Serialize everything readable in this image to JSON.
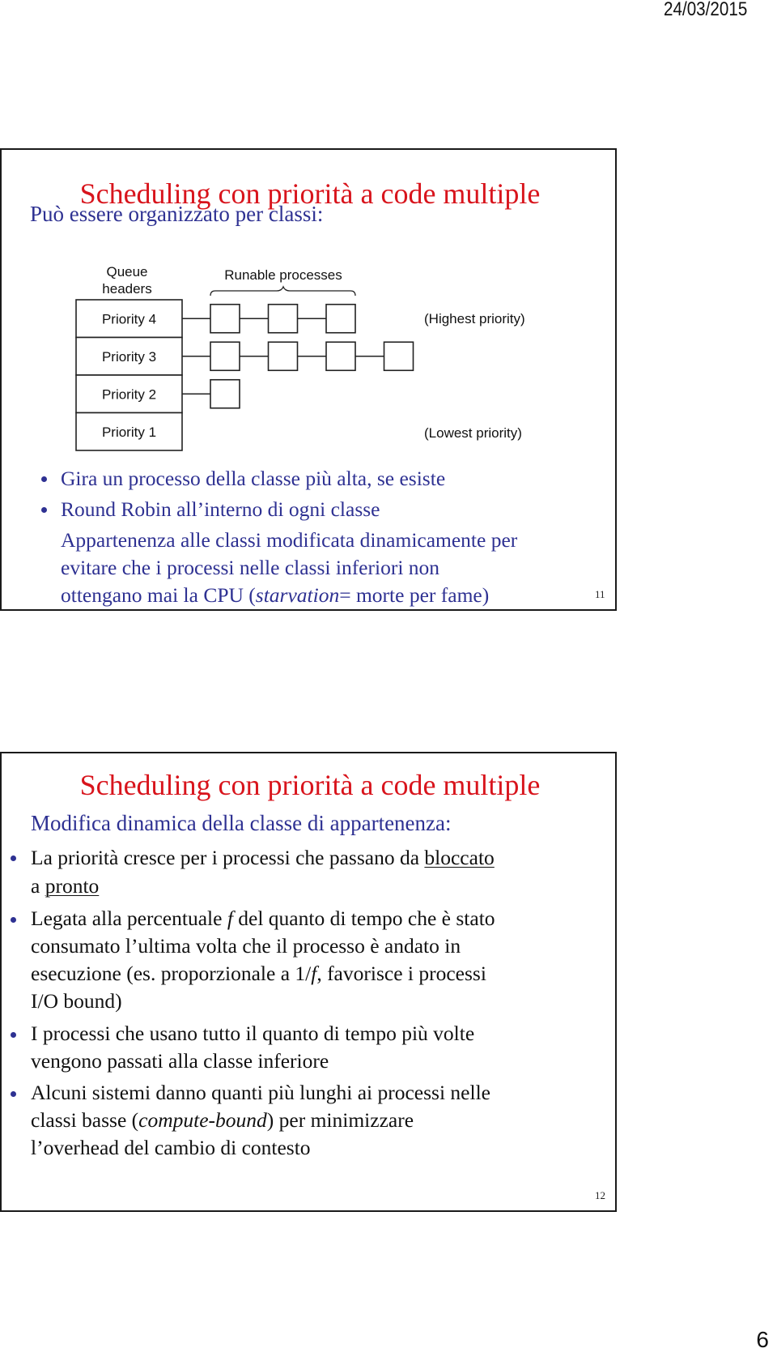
{
  "page": {
    "date": "24/03/2015",
    "page_number": "6"
  },
  "slides": [
    {
      "number": "11",
      "title": "Scheduling con priorità a code multiple",
      "subtitle": "Può essere organizzato per classi:",
      "diagram": {
        "header_label_line1": "Queue",
        "header_label_line2": "headers",
        "processes_label": "Runable processes",
        "highest_label": "(Highest priority)",
        "lowest_label": "(Lowest priority)",
        "queues": [
          {
            "label": "Priority 4",
            "process_count": 3
          },
          {
            "label": "Priority 3",
            "process_count": 4
          },
          {
            "label": "Priority 2",
            "process_count": 1
          },
          {
            "label": "Priority 1",
            "process_count": 0
          }
        ]
      },
      "bullets": [
        "Gira un processo della classe più alta, se esiste",
        "Round Robin all’interno di ogni classe"
      ],
      "paragraph": {
        "line1": "Appartenenza alle classi modificata dinamicamente per",
        "line2": "evitare che i processi nelle classi inferiori non",
        "line3_pre": "ottengano mai la CPU (",
        "line3_em": "starvation",
        "line3_post": "= morte per fame)"
      }
    },
    {
      "number": "12",
      "title": "Scheduling con priorità a code multiple",
      "subtitle": "Modifica dinamica della classe di appartenenza:",
      "bullets": [
        {
          "pre": "La priorità cresce per i processi che passano da ",
          "u1": "bloccato",
          "mid": "a ",
          "u2": "pronto"
        },
        {
          "line1_pre": "Legata alla percentuale ",
          "line1_em": "f",
          "line1_post": " del quanto di tempo che è stato",
          "line2": "consumato l’ultima volta che il processo è andato in",
          "line3_pre": "esecuzione (es. proporzionale a 1/",
          "line3_em": "f",
          "line3_post": ", favorisce i processi",
          "line4": "I/O bound)"
        },
        {
          "line1": "I processi che usano tutto il quanto di tempo più volte",
          "line2": "vengono passati alla classe inferiore"
        },
        {
          "line1": "Alcuni sistemi danno quanti più lunghi ai processi nelle",
          "line2_pre": "classi basse (",
          "line2_em": "compute-bound",
          "line2_post": ") per minimizzare",
          "line3": "l’overhead del cambio di contesto"
        }
      ]
    }
  ]
}
